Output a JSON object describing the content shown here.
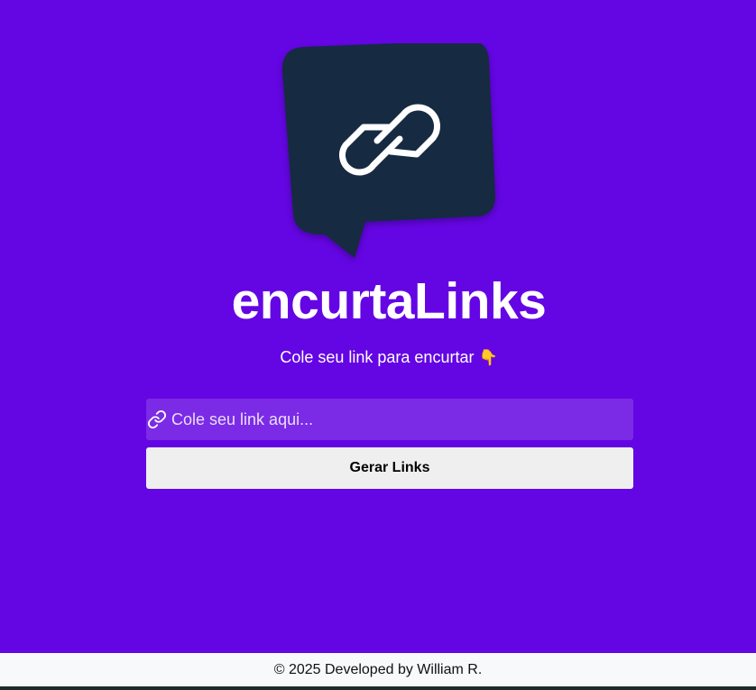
{
  "app": {
    "title": "encurtaLinks",
    "subtitle": "Cole seu link para encurtar",
    "subtitle_emoji": "👇"
  },
  "logo": {
    "icon": "chain-link-icon",
    "bubble_color": "#152a42",
    "link_color": "#ffffff"
  },
  "form": {
    "input_placeholder": "Cole seu link aqui...",
    "input_value": "",
    "input_icon": "link-icon",
    "submit_label": "Gerar Links"
  },
  "footer": {
    "text": "© 2025 Developed by William R."
  },
  "colors": {
    "background": "#6405e4",
    "input_background": "#7b2be6",
    "button_background": "#efefef",
    "footer_background": "#f7f9fa"
  }
}
